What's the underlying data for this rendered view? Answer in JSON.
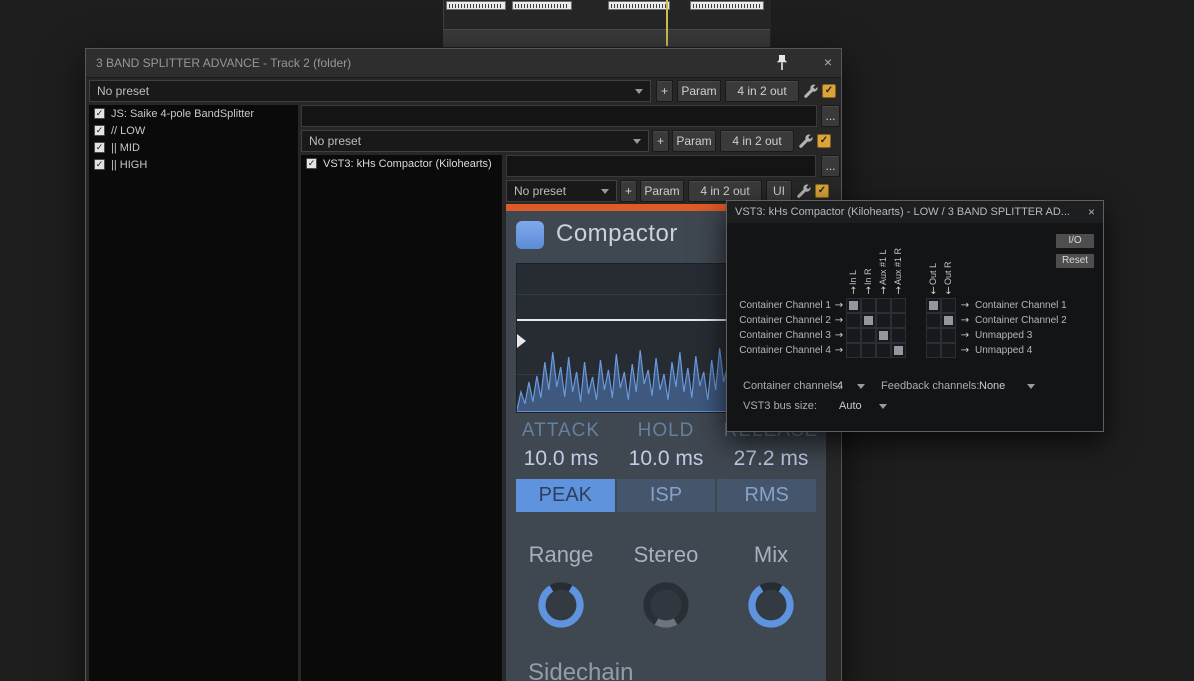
{
  "icons": {
    "check": "✓",
    "up_arrow": "↑",
    "down_arrow": "↓",
    "right_arrow": "→",
    "close": "×",
    "more": "..."
  },
  "window": {
    "title": "3 BAND SPLITTER ADVANCE - Track 2 (folder)"
  },
  "chain": {
    "preset": "No preset",
    "add_label": "+",
    "param_label": "Param",
    "io_label": "4 in 2 out",
    "ui_label": "UI"
  },
  "fx_list": [
    "JS: Saike 4-pole BandSplitter",
    "// LOW",
    "|| MID",
    "|| HIGH"
  ],
  "container_fx_list": [
    "VST3: kHs Compactor (Kilohearts)"
  ],
  "compactor": {
    "title": "Compactor",
    "params": [
      {
        "label": "ATTACK",
        "value": "10.0 ms"
      },
      {
        "label": "HOLD",
        "value": "10.0 ms"
      },
      {
        "label": "RELEASE",
        "value": "27.2 ms"
      }
    ],
    "modes": [
      "PEAK",
      "ISP",
      "RMS"
    ],
    "selected_mode": "PEAK",
    "knobs": [
      "Range",
      "Stereo",
      "Mix"
    ],
    "sidechain": "Sidechain"
  },
  "routing": {
    "title": "VST3: kHs Compactor (Kilohearts) - LOW / 3 BAND SPLITTER AD...",
    "io_button": "I/O",
    "reset_button": "Reset",
    "input_pins": [
      "In L",
      "In R",
      "Aux #1 L",
      "Aux #1 R"
    ],
    "output_pins": [
      "Out L",
      "Out R"
    ],
    "source_rows": [
      "Container Channel 1",
      "Container Channel 2",
      "Container Channel 3",
      "Container Channel 4"
    ],
    "dest_rows": [
      "Container Channel 1",
      "Container Channel 2",
      "Unmapped 3",
      "Unmapped 4"
    ],
    "left_matrix": [
      [
        1,
        0,
        0,
        0
      ],
      [
        0,
        1,
        0,
        0
      ],
      [
        0,
        0,
        1,
        0
      ],
      [
        0,
        0,
        0,
        1
      ]
    ],
    "right_matrix": [
      [
        1,
        0
      ],
      [
        0,
        1
      ],
      [
        0,
        0
      ],
      [
        0,
        0
      ]
    ],
    "container_channels_label": "Container channels:",
    "container_channels_value": "4",
    "feedback_label": "Feedback channels:",
    "feedback_value": "None",
    "bus_size_label": "VST3 bus size:",
    "bus_size_value": "Auto"
  }
}
